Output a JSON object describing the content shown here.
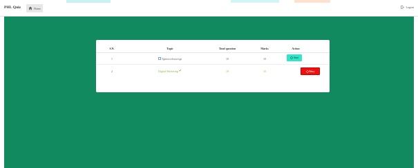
{
  "navbar": {
    "brand": "PHL Quiz",
    "home_label": "Home",
    "logout_label": "Logout"
  },
  "table": {
    "headers": {
      "sn": "S.N.",
      "topic": "Topic",
      "total": "Total question",
      "marks": "Marks",
      "action": "Action"
    },
    "rows": [
      {
        "sn": "1",
        "topic": "Tgmtsvsdvsrsvsgs",
        "total": "10",
        "marks": "10",
        "action": "Start"
      },
      {
        "sn": "2",
        "topic": "Digital Marketing",
        "total": "10",
        "marks": "10",
        "action": "Retry"
      }
    ]
  },
  "colors": {
    "background": "#118a5f",
    "start_button": "#2ee6c9",
    "retry_button": "#ee1111",
    "completed_text": "#8bc34a"
  }
}
